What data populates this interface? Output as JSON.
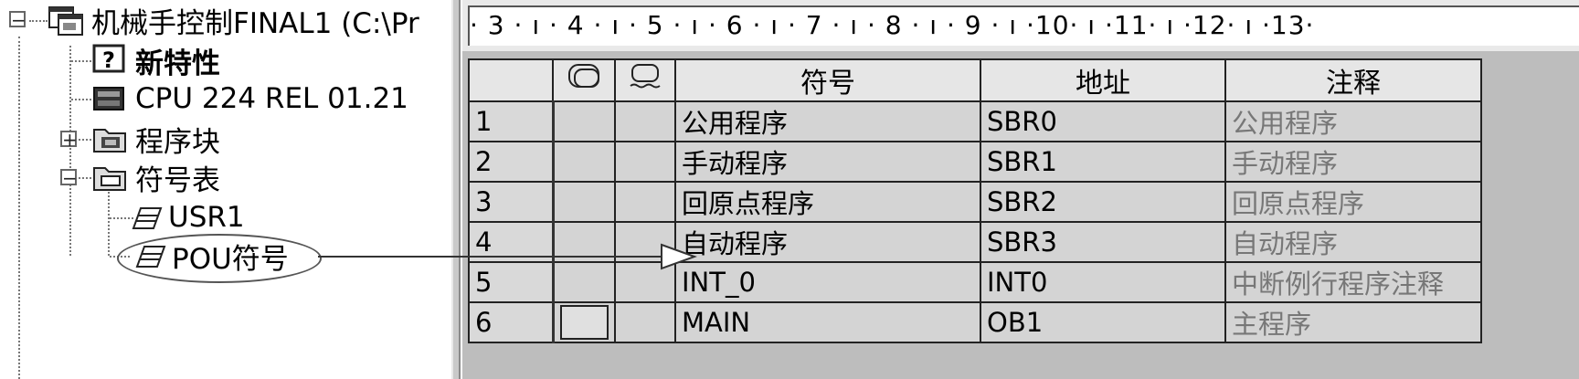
{
  "tree": {
    "root_label": "机械手控制FINAL1 (C:\\Pr",
    "items": [
      {
        "label": "新特性",
        "bold": true,
        "icon": "question-icon"
      },
      {
        "label": "CPU 224 REL 01.21",
        "bold": false,
        "icon": "cpu-icon"
      },
      {
        "label": "程序块",
        "bold": false,
        "icon": "folder-block-icon"
      },
      {
        "label": "符号表",
        "bold": false,
        "icon": "folder-symbol-icon"
      },
      {
        "label": "USR1",
        "bold": false,
        "icon": "table-icon"
      },
      {
        "label": "POU符号",
        "bold": false,
        "icon": "table-icon"
      }
    ],
    "expand_glyphs": {
      "collapse": "−",
      "expand": "+"
    }
  },
  "ruler": {
    "text": "· 3 · ı · 4 · ı · 5 · ı · 6 · ı · 7 · ı · 8 · ı · 9 · ı ·10· ı ·11· ı ·12· ı ·13·"
  },
  "table": {
    "headers": [
      "",
      "",
      "",
      "符号",
      "地址",
      "注释"
    ],
    "rows": [
      {
        "num": "1",
        "symbol": "公用程序",
        "address": "SBR0",
        "comment": "公用程序"
      },
      {
        "num": "2",
        "symbol": "手动程序",
        "address": "SBR1",
        "comment": "手动程序"
      },
      {
        "num": "3",
        "symbol": "回原点程序",
        "address": "SBR2",
        "comment": "回原点程序"
      },
      {
        "num": "4",
        "symbol": "自动程序",
        "address": "SBR3",
        "comment": "自动程序"
      },
      {
        "num": "5",
        "symbol": "INT_0",
        "address": "INT0",
        "comment": "中断例行程序注释"
      },
      {
        "num": "6",
        "symbol": "MAIN",
        "address": "OB1",
        "comment": "主程序"
      }
    ]
  }
}
